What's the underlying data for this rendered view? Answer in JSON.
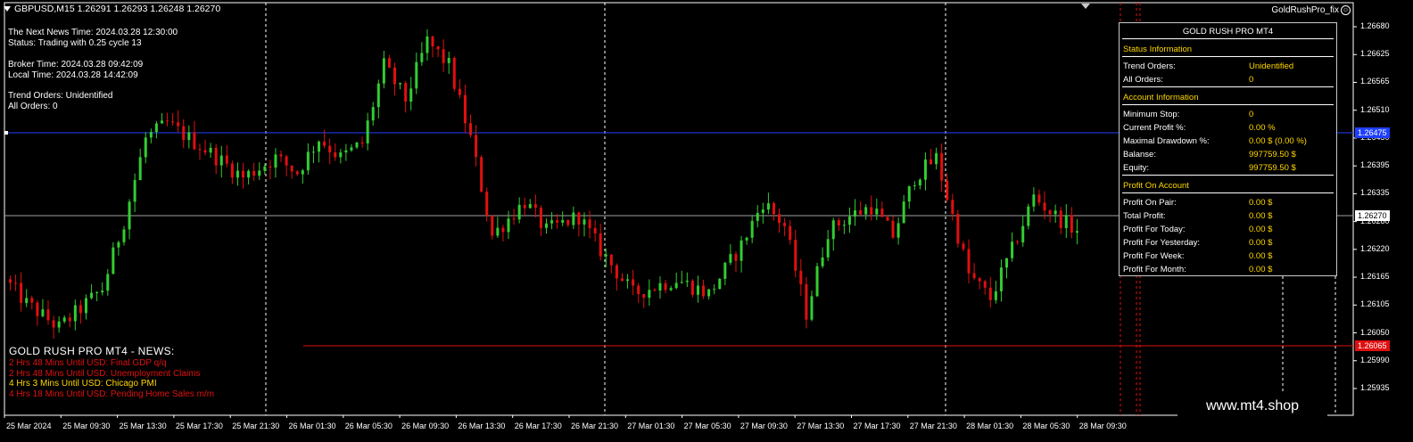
{
  "symbol_header": "GBPUSD,M15  1.26291 1.26293 1.26248 1.26270",
  "ea_label": "GoldRushPro_fix",
  "info_lines": {
    "next_news": "The Next News Time: 2024.03.28 12:30:00",
    "status": "Status: Trading with 0.25 cycle 13",
    "broker_time": "Broker Time: 2024.03.28 09:42:09",
    "local_time": "Local Time: 2024.03.28 14:42:09",
    "trend_orders": "Trend Orders: Unidentified",
    "all_orders": "All Orders: 0"
  },
  "panel": {
    "title": "GOLD RUSH PRO MT4",
    "status_header": "Status Information",
    "status_rows": [
      {
        "k": "Trend Orders:",
        "v": "Unidentified"
      },
      {
        "k": "All Orders:",
        "v": "0"
      }
    ],
    "account_header": "Account Information",
    "account_rows": [
      {
        "k": "Minimum Stop:",
        "v": "0"
      },
      {
        "k": "Current Profit %:",
        "v": "0.00 %"
      },
      {
        "k": "Maximal Drawdown %:",
        "v": "0.00 $ (0.00 %)"
      },
      {
        "k": "Balanse:",
        "v": "997759.50 $"
      },
      {
        "k": "Equity:",
        "v": "997759.50 $"
      }
    ],
    "profit_header": "Profit On Account",
    "profit_rows": [
      {
        "k": "Profit On Pair:",
        "v": "0.00 $"
      },
      {
        "k": "Total Profit:",
        "v": "0.00 $"
      },
      {
        "k": "Profit For Today:",
        "v": "0.00 $"
      },
      {
        "k": "Profit For Yesterday:",
        "v": "0.00 $"
      },
      {
        "k": "Profit For Week:",
        "v": "0.00 $"
      },
      {
        "k": "Profit For Month:",
        "v": "0.00 $"
      }
    ]
  },
  "news": {
    "title": "GOLD RUSH PRO MT4 - NEWS:",
    "items": [
      {
        "text": "2 Hrs 48 Mins Until USD: Final GDP q/q",
        "color": "#e01010"
      },
      {
        "text": "2 Hrs 48 Mins Until USD: Unemployment Claims",
        "color": "#e01010"
      },
      {
        "text": "4 Hrs 3 Mins Until USD: Chicago PMI",
        "color": "#ffd700"
      },
      {
        "text": "4 Hrs 18 Mins Until USD: Pending Home Sales m/m",
        "color": "#e01010"
      }
    ]
  },
  "watermark": "www.mt4.shop",
  "colors": {
    "bull": "#32cd32",
    "bear": "#e01010",
    "blue_line": "#1f3fff",
    "red_line": "#e01010",
    "current_line": "#a0a0a0",
    "yellow": "#ffd700"
  },
  "chart_data": {
    "type": "candlestick",
    "symbol": "GBPUSD",
    "timeframe": "M15",
    "y_ticks": [
      "1.26680",
      "1.26625",
      "1.26565",
      "1.26510",
      "1.26450",
      "1.26395",
      "1.26335",
      "1.26280",
      "1.26220",
      "1.26165",
      "1.26105",
      "1.26050",
      "1.25990",
      "1.25935"
    ],
    "ylim": [
      1.25935,
      1.2668
    ],
    "x_ticks": [
      "25 Mar 2024",
      "25 Mar 09:30",
      "25 Mar 13:30",
      "25 Mar 17:30",
      "25 Mar 21:30",
      "26 Mar 01:30",
      "26 Mar 05:30",
      "26 Mar 09:30",
      "26 Mar 13:30",
      "26 Mar 17:30",
      "26 Mar 21:30",
      "27 Mar 01:30",
      "27 Mar 05:30",
      "27 Mar 09:30",
      "27 Mar 13:30",
      "27 Mar 17:30",
      "27 Mar 21:30",
      "28 Mar 01:30",
      "28 Mar 05:30",
      "28 Mar 09:30"
    ],
    "horizontal_levels": [
      {
        "label": "1.26475",
        "role": "blue"
      },
      {
        "label": "1.26270",
        "role": "current"
      },
      {
        "label": "1.26065",
        "role": "red"
      }
    ],
    "day_separators": [
      "25 Mar 21:30",
      "26 Mar 21:30",
      "27 Mar 21:30"
    ],
    "path_waypoints": [
      [
        0,
        1.2616
      ],
      [
        4,
        1.2611
      ],
      [
        10,
        1.2606
      ],
      [
        18,
        1.2614
      ],
      [
        22,
        1.2628
      ],
      [
        26,
        1.2645
      ],
      [
        30,
        1.2648
      ],
      [
        38,
        1.2642
      ],
      [
        44,
        1.2637
      ],
      [
        50,
        1.2641
      ],
      [
        54,
        1.2638
      ],
      [
        58,
        1.2645
      ],
      [
        62,
        1.2641
      ],
      [
        66,
        1.2644
      ],
      [
        70,
        1.266
      ],
      [
        74,
        1.2653
      ],
      [
        78,
        1.2665
      ],
      [
        82,
        1.266
      ],
      [
        86,
        1.2645
      ],
      [
        90,
        1.2625
      ],
      [
        96,
        1.2632
      ],
      [
        100,
        1.2626
      ],
      [
        106,
        1.2629
      ],
      [
        110,
        1.2622
      ],
      [
        116,
        1.2613
      ],
      [
        124,
        1.2616
      ],
      [
        130,
        1.2613
      ],
      [
        136,
        1.2623
      ],
      [
        140,
        1.2632
      ],
      [
        144,
        1.2627
      ],
      [
        148,
        1.2609
      ],
      [
        152,
        1.2626
      ],
      [
        156,
        1.2629
      ],
      [
        160,
        1.2631
      ],
      [
        164,
        1.2625
      ],
      [
        168,
        1.2637
      ],
      [
        172,
        1.2641
      ],
      [
        176,
        1.2625
      ],
      [
        178,
        1.2617
      ],
      [
        182,
        1.2612
      ],
      [
        186,
        1.2622
      ],
      [
        190,
        1.2633
      ],
      [
        194,
        1.2629
      ],
      [
        198,
        1.2626
      ]
    ],
    "summary_ohlc": {
      "open": "1.26291",
      "high": "1.26293",
      "low": "1.26248",
      "close": "1.26270"
    }
  }
}
